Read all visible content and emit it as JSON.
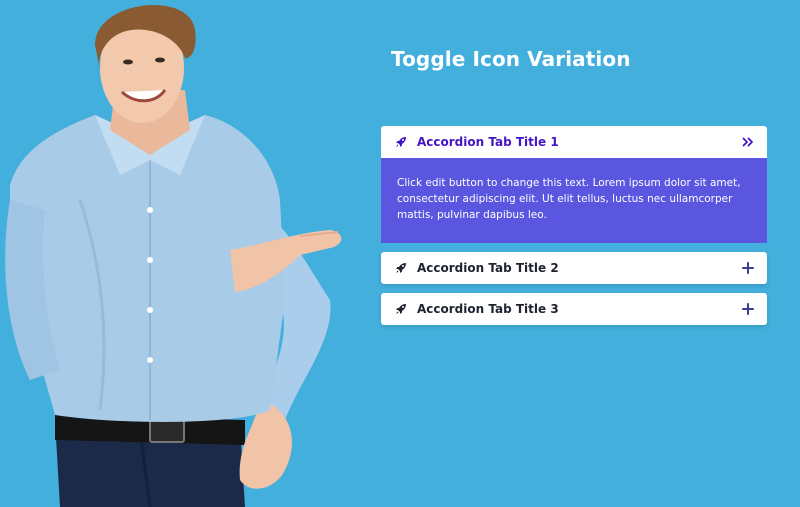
{
  "page": {
    "background_color": "#43afdc",
    "title": "Toggle Icon Variation"
  },
  "accordion": {
    "active_header_text_color": "#4415c4",
    "active_body_color": "#5a56e0",
    "items": [
      {
        "title": "Accordion Tab Title 1",
        "icon": "rocket-icon",
        "toggle_icon": "double-chevron-right-icon",
        "expanded": true,
        "content": "Click edit button to change this text. Lorem ipsum dolor sit amet, consectetur adipiscing elit. Ut elit tellus, luctus nec ullamcorper mattis, pulvinar dapibus leo."
      },
      {
        "title": "Accordion Tab Title 2",
        "icon": "rocket-icon",
        "toggle_icon": "plus-icon",
        "expanded": false
      },
      {
        "title": "Accordion Tab Title 3",
        "icon": "rocket-icon",
        "toggle_icon": "plus-icon",
        "expanded": false
      }
    ]
  }
}
